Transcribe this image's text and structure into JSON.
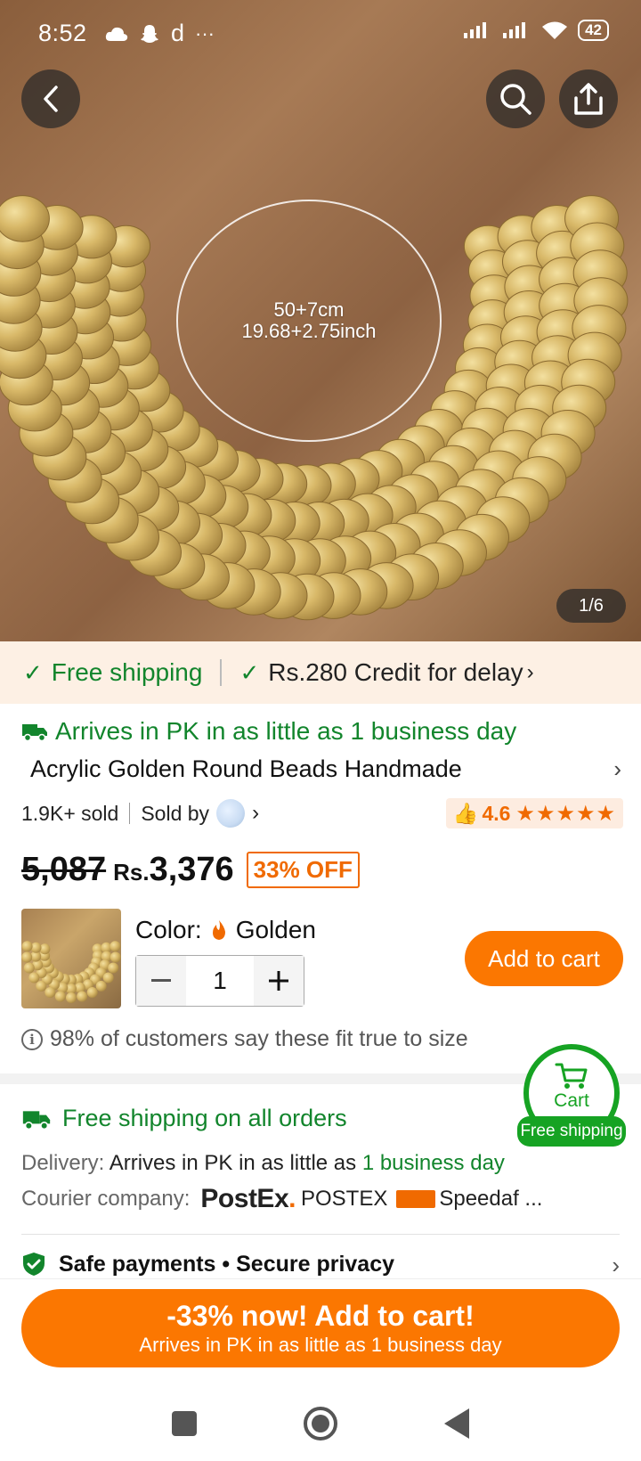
{
  "status_bar": {
    "time": "8:52",
    "left_icons": [
      "cloud-icon",
      "snapchat-icon",
      "d",
      "..."
    ],
    "battery": "42"
  },
  "hero": {
    "size_text_line1": "50+7cm",
    "size_text_line2": "19.68+2.75inch",
    "image_counter": "1/6"
  },
  "banner": {
    "free_shipping": "Free shipping",
    "credit": "Rs.280 Credit for delay"
  },
  "product": {
    "arrives": "Arrives in PK in as little as 1 business day",
    "title": "Acrylic Golden Round Beads Handmade",
    "sold": "1.9K+ sold",
    "sold_by": "Sold by",
    "rating": "4.6",
    "stars": "★★★★★",
    "old_price": "5,087",
    "currency": "Rs.",
    "price": "3,376",
    "discount": "33% OFF",
    "color_label": "Color:",
    "color_value": "Golden",
    "quantity": "1",
    "add_to_cart": "Add to cart",
    "fit_text": "98% of customers say these fit true to size"
  },
  "floating_cart": {
    "label": "Cart",
    "badge": "Free shipping"
  },
  "shipping": {
    "free_all": "Free shipping on all orders",
    "delivery_label": "Delivery:",
    "delivery_text": "Arrives in PK in as little as",
    "delivery_highlight": "1 business day",
    "courier_label": "Courier company:",
    "postex_logo": "PostEx",
    "courier1": "POSTEX",
    "speedaf_logo": "Speedaf",
    "courier2": "Speedaf ...",
    "safe_payments": "Safe payments • Secure privacy"
  },
  "cta": {
    "main": "-33% now! Add to cart!",
    "sub": "Arrives in PK in as little as 1 business day"
  },
  "colors": {
    "accent_orange": "#fb7701",
    "green": "#12852c",
    "cart_green": "#16a323",
    "banner_bg": "#fdf0e4"
  }
}
